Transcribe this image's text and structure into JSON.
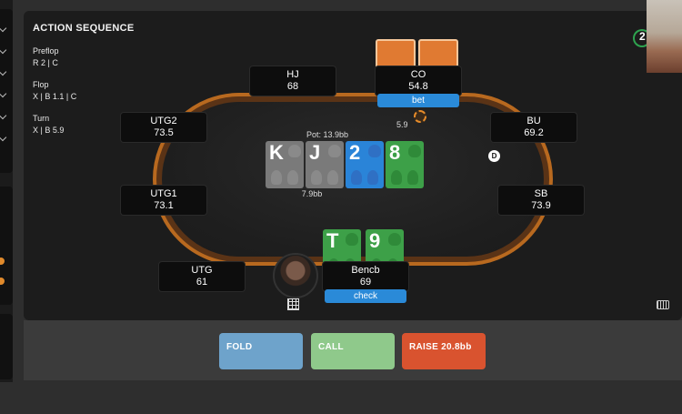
{
  "action_sequence": {
    "title": "ACTION SEQUENCE",
    "streets": [
      {
        "name": "Preflop",
        "actions": "R 2 | C"
      },
      {
        "name": "Flop",
        "actions": "X | B 1.1 | C"
      },
      {
        "name": "Turn",
        "actions": "X | B 5.9"
      }
    ]
  },
  "table": {
    "pot_label": "Pot: 13.9bb",
    "pot_below": "7.9bb",
    "bet_amount": "5.9",
    "dealer_label": "D",
    "board": [
      {
        "rank": "K",
        "suit_color": "#8a8a8a",
        "bg": "#7a7a7a"
      },
      {
        "rank": "J",
        "suit_color": "#8a8a8a",
        "bg": "#7a7a7a"
      },
      {
        "rank": "2",
        "suit_color": "#2f70c4",
        "bg": "#2a84d8"
      },
      {
        "rank": "8",
        "suit_color": "#2f8a39",
        "bg": "#3da048"
      }
    ],
    "hero_cards": [
      {
        "rank": "T",
        "suit_color": "#2f8a39",
        "bg": "#3da048"
      },
      {
        "rank": "9",
        "suit_color": "#2f8a39",
        "bg": "#3da048"
      }
    ]
  },
  "seats": {
    "hj": {
      "name": "HJ",
      "stack": "68"
    },
    "co": {
      "name": "CO",
      "stack": "54.8",
      "action": "bet"
    },
    "utg2": {
      "name": "UTG2",
      "stack": "73.5"
    },
    "bu": {
      "name": "BU",
      "stack": "69.2"
    },
    "utg1": {
      "name": "UTG1",
      "stack": "73.1"
    },
    "sb": {
      "name": "SB",
      "stack": "73.9"
    },
    "utg": {
      "name": "UTG",
      "stack": "61"
    },
    "hero": {
      "name": "Bencb",
      "stack": "69",
      "action": "check"
    }
  },
  "timer_label": "2",
  "buttons": {
    "fold": "FOLD",
    "call": "CALL",
    "raise": "RAISE 20.8bb"
  },
  "colors": {
    "felt_border": "#b8691f",
    "fold": "#6ea3cb",
    "call": "#8fc98b",
    "raise": "#d9532f",
    "action_tag": "#2a8ad8"
  }
}
